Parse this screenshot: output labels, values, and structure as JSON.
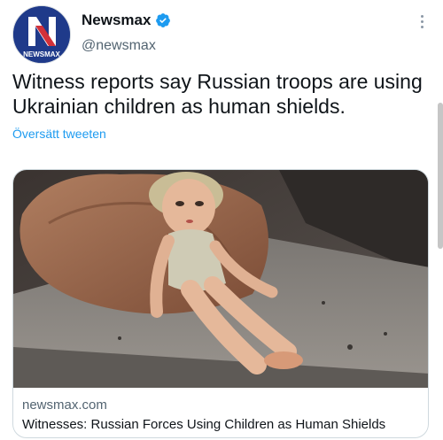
{
  "author": {
    "name": "Newsmax",
    "handle": "@newsmax",
    "avatar_label": "NEWSMAX",
    "avatar_letter": "N"
  },
  "tweet": {
    "text": "Witness reports say Russian troops are using Ukrainian children as human shields.",
    "translate_label": "Översätt tweeten"
  },
  "link_card": {
    "domain": "newsmax.com",
    "headline": "Witnesses: Russian Forces Using Children as Human Shields"
  },
  "icons": {
    "verified": "verified-badge-icon",
    "more": "more-options-icon"
  },
  "colors": {
    "link": "#1d9bf0",
    "verified": "#1d9bf0",
    "brand": "#1f3a8a",
    "brand_red": "#d0262f"
  }
}
